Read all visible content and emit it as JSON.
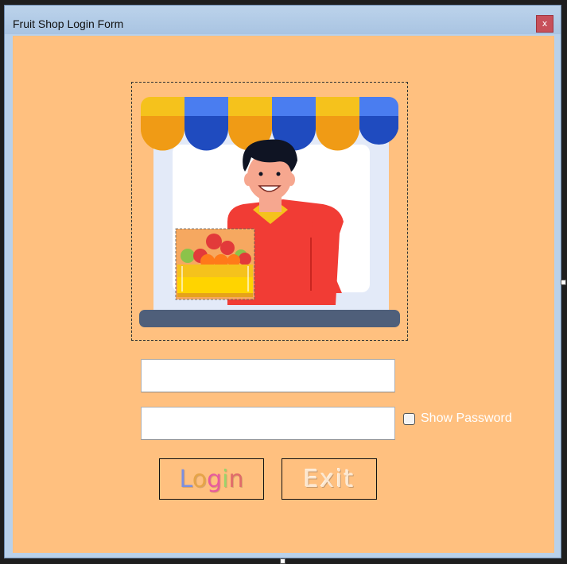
{
  "window": {
    "title": "Fruit Shop Login Form",
    "close_label": "x"
  },
  "form": {
    "username_value": "",
    "password_value": "",
    "show_password_label": "Show Password",
    "show_password_checked": false
  },
  "buttons": {
    "login_label": "Login",
    "login_letter_colors": [
      "#7b8fe0",
      "#e6a447",
      "#e85a9d",
      "#9ad46a",
      "#e06a6a"
    ],
    "exit_label": "Exit"
  },
  "colors": {
    "form_background": "#ffc07f",
    "titlebar": "#b9d1ea",
    "awning_yellow": "#f5c21c",
    "awning_blue": "#4a7df0",
    "shirt_red": "#f13c35"
  }
}
